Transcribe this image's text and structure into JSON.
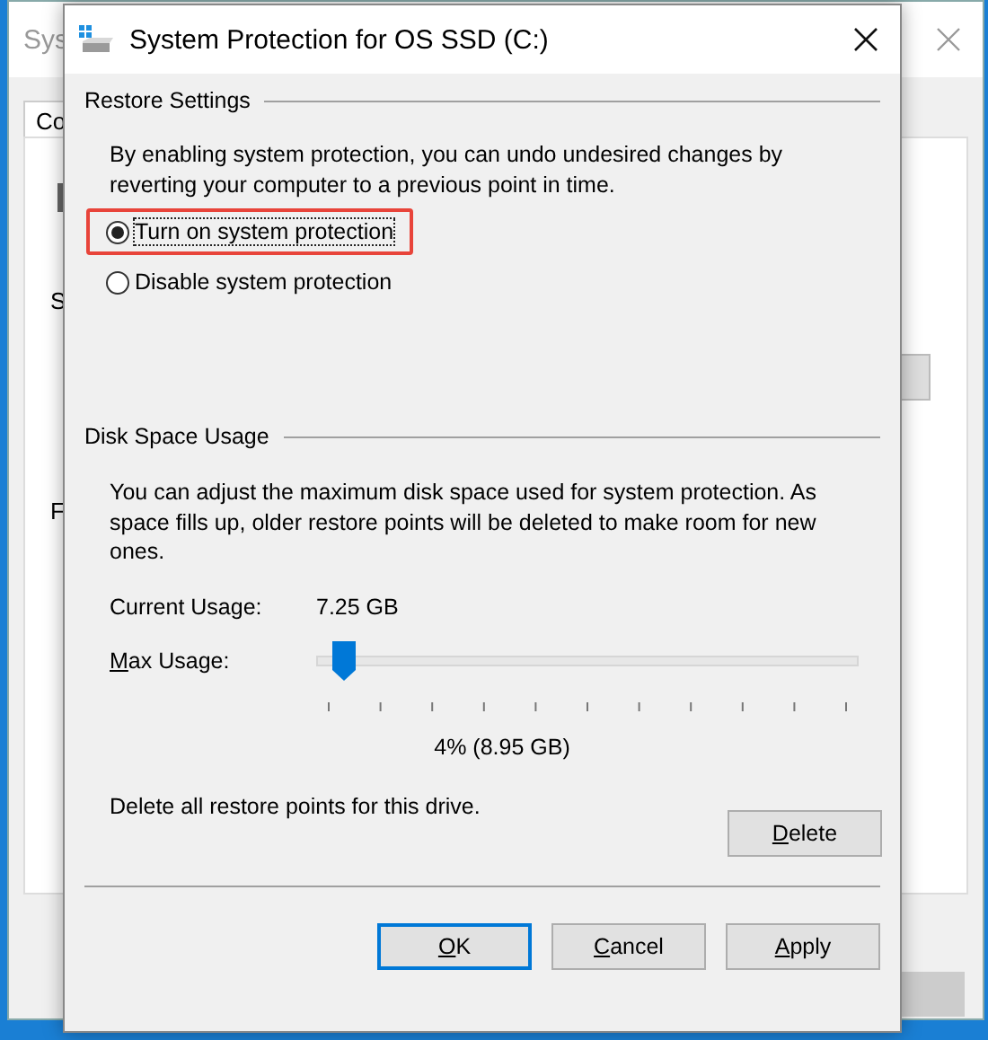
{
  "background_window": {
    "title": "Sys",
    "tab": "Co",
    "labels": [
      "S",
      "F"
    ]
  },
  "dialog": {
    "title": "System Protection for OS SSD (C:)",
    "restore_settings": {
      "heading": "Restore Settings",
      "description": "By enabling system protection, you can undo undesired changes by reverting your computer to a previous point in time.",
      "options": [
        {
          "label": "Turn on system protection",
          "selected": true,
          "focused": true,
          "highlighted": true
        },
        {
          "label": "Disable system protection",
          "selected": false,
          "focused": false,
          "highlighted": false
        }
      ]
    },
    "disk_space_usage": {
      "heading": "Disk Space Usage",
      "description": "You can adjust the maximum disk space used for system protection. As space fills up, older restore points will be deleted to make room for new ones.",
      "current_usage_label": "Current Usage:",
      "current_usage_value": "7.25 GB",
      "max_usage_label": {
        "text": "Max Usage:",
        "mnemonic": true
      },
      "max_usage": {
        "level": 0.04
      },
      "max_usage_reading": "4% (8.95 GB)",
      "delete_text": "Delete all restore points for this drive.",
      "delete_button": {
        "label": "Delete",
        "mnemonic": true
      }
    },
    "buttons": [
      {
        "label": "OK",
        "default": true,
        "mnemonic": true
      },
      {
        "label": "Cancel",
        "default": false,
        "mnemonic": true
      },
      {
        "label": "Apply",
        "default": false,
        "mnemonic": true
      }
    ]
  }
}
